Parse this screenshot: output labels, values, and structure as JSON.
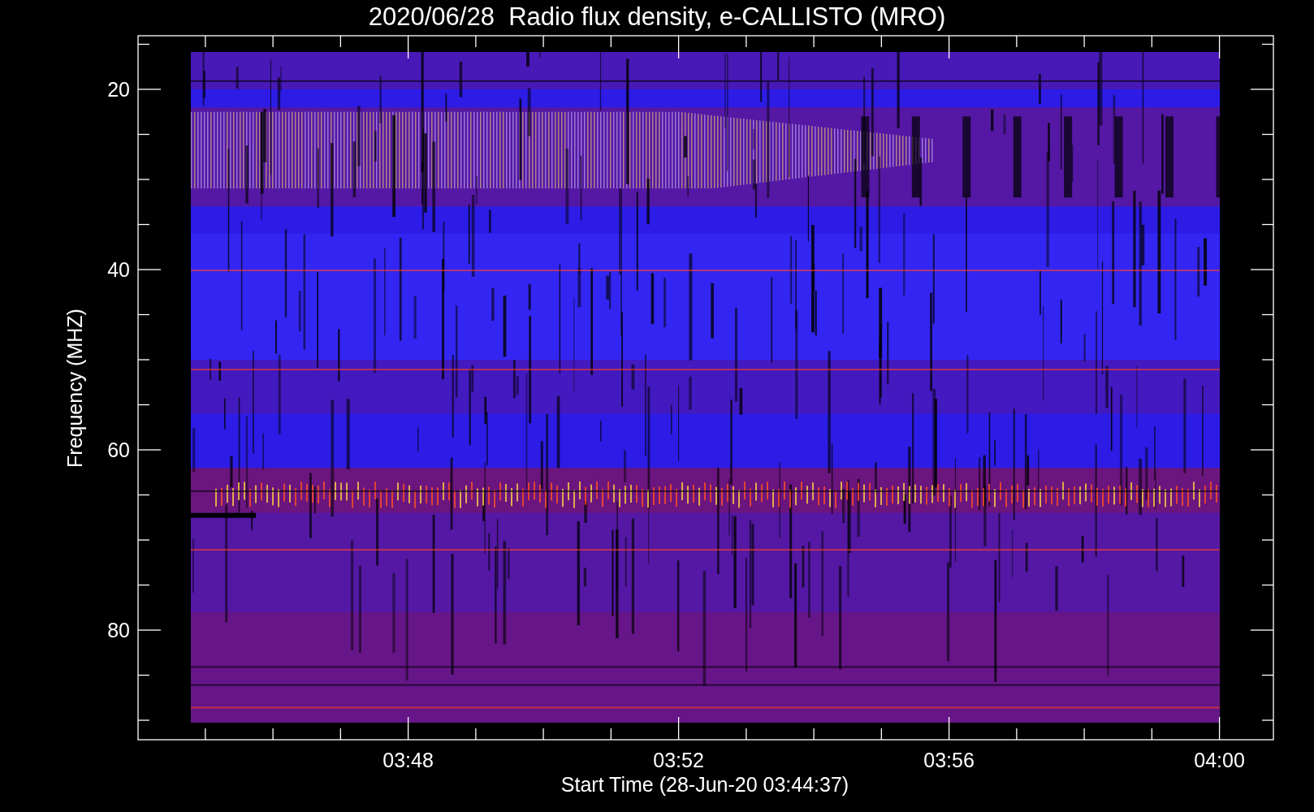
{
  "title": "2020/06/28  Radio flux density, e-CALLISTO (MRO)",
  "y_axis": {
    "label": "Frequency (MHZ)",
    "ticks": [
      "20",
      "40",
      "60",
      "80"
    ]
  },
  "x_axis": {
    "label": "Start Time (28-Jun-20 03:44:37)",
    "ticks": [
      "03:48",
      "03:52",
      "03:56",
      "04:00"
    ]
  }
}
